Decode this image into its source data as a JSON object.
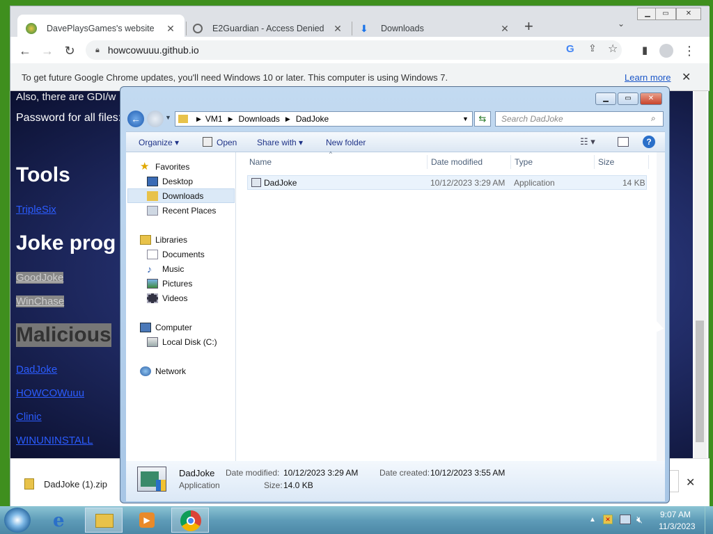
{
  "chrome": {
    "tabs": [
      {
        "title": "DavePlaysGames's website"
      },
      {
        "title": "E2Guardian - Access Denied"
      },
      {
        "title": "Downloads"
      }
    ],
    "new_tab_symbol": "+",
    "url": "howcowuuu.github.io",
    "infobar_text": "To get future Google Chrome updates, you'll need Windows 10 or later. This computer is using Windows 7.",
    "infobar_link": "Learn more"
  },
  "page": {
    "line1": "Also, there are GDI/w",
    "password": "Password for all files:",
    "tools_heading": "Tools",
    "tools_links": [
      "TripleSix"
    ],
    "joke_heading": "Joke prog",
    "joke_links": [
      "GoodJoke",
      "WinChase"
    ],
    "malicious_heading": "Malicious",
    "malicious_links": [
      "DadJoke",
      "HOWCOWuuu",
      "Clinic",
      "WINUNINSTALL"
    ]
  },
  "download_bar": {
    "filename": "DadJoke (1).zip"
  },
  "explorer": {
    "breadcrumb": [
      "VM1",
      "Downloads",
      "DadJoke"
    ],
    "search_placeholder": "Search DadJoke",
    "commands": {
      "organize": "Organize",
      "open": "Open",
      "share": "Share with",
      "new_folder": "New folder"
    },
    "nav": {
      "favorites": "Favorites",
      "favorites_items": [
        "Desktop",
        "Downloads",
        "Recent Places"
      ],
      "libraries": "Libraries",
      "libraries_items": [
        "Documents",
        "Music",
        "Pictures",
        "Videos"
      ],
      "computer": "Computer",
      "computer_items": [
        "Local Disk (C:)"
      ],
      "network": "Network"
    },
    "columns": {
      "name": "Name",
      "date": "Date modified",
      "type": "Type",
      "size": "Size"
    },
    "file": {
      "name": "DadJoke",
      "date": "10/12/2023 3:29 AM",
      "type": "Application",
      "size": "14 KB"
    },
    "details": {
      "name": "DadJoke",
      "kind": "Application",
      "modified_label": "Date modified:",
      "modified": "10/12/2023 3:29 AM",
      "created_label": "Date created:",
      "created": "10/12/2023 3:55 AM",
      "size_label": "Size:",
      "size": "14.0 KB"
    }
  },
  "taskbar": {
    "time": "9:07 AM",
    "date": "11/3/2023"
  },
  "colors": {
    "link": "#2b5cff",
    "chrome_tabstrip": "#dee1e6",
    "taskbar": "#5e9cb8"
  }
}
